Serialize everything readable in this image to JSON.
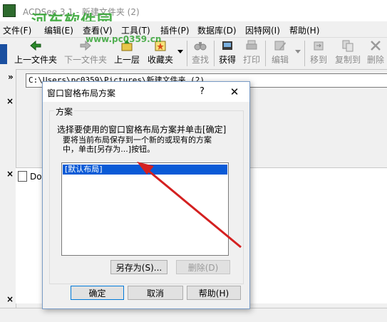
{
  "window": {
    "title": "ACDSee 3.1 - 新建文件夹 (2)"
  },
  "watermark": {
    "logo_text": "河东软件园",
    "url": "www.pc0359.cn"
  },
  "menubar": {
    "items": [
      "文件(F)",
      "编辑(E)",
      "查看(V)",
      "工具(T)",
      "插件(P)",
      "数据库(D)",
      "因特网(I)",
      "帮助(H)"
    ]
  },
  "toolbar": {
    "buttons": [
      {
        "label": "上一文件夹",
        "icon": "arrow-left-icon",
        "enabled": true
      },
      {
        "label": "下一文件夹",
        "icon": "arrow-right-icon",
        "enabled": false
      },
      {
        "label": "上一层",
        "icon": "folder-up-icon",
        "enabled": true
      },
      {
        "label": "收藏夹",
        "icon": "favorites-icon",
        "enabled": true
      },
      {
        "label": "查找",
        "icon": "binoculars-icon",
        "enabled": false
      },
      {
        "label": "获得",
        "icon": "acquire-icon",
        "enabled": true
      },
      {
        "label": "打印",
        "icon": "printer-icon",
        "enabled": false
      },
      {
        "label": "编辑",
        "icon": "edit-icon",
        "enabled": false
      },
      {
        "label": "移到",
        "icon": "move-icon",
        "enabled": false
      },
      {
        "label": "复制到",
        "icon": "copy-icon",
        "enabled": false
      },
      {
        "label": "删除",
        "icon": "delete-icon",
        "enabled": false
      }
    ]
  },
  "address": {
    "path": "C:\\Users\\pc0359\\Pictures\\新建文件夹 (2)"
  },
  "pane": {
    "doc_item": "Do",
    "close_glyph": "×"
  },
  "dialog": {
    "title": "窗口窗格布局方案",
    "help_glyph": "?",
    "close_glyph": "✕",
    "group_label": "方案",
    "description_line1": "选择要使用的窗口窗格布局方案并单击[确定]",
    "description_line2": "要将当前布局保存到一个新的或现有的方案",
    "description_line3": "中，单击[另存为...]按钮。",
    "list_items": [
      "[默认布局]"
    ],
    "save_as_label": "另存为(S)...",
    "delete_label": "删除(D)",
    "ok_label": "确定",
    "cancel_label": "取消",
    "help_label": "帮助(H)"
  },
  "colors": {
    "selection": "#0a5ad6",
    "arrow": "#d42020",
    "watermark": "#2aa02a"
  }
}
